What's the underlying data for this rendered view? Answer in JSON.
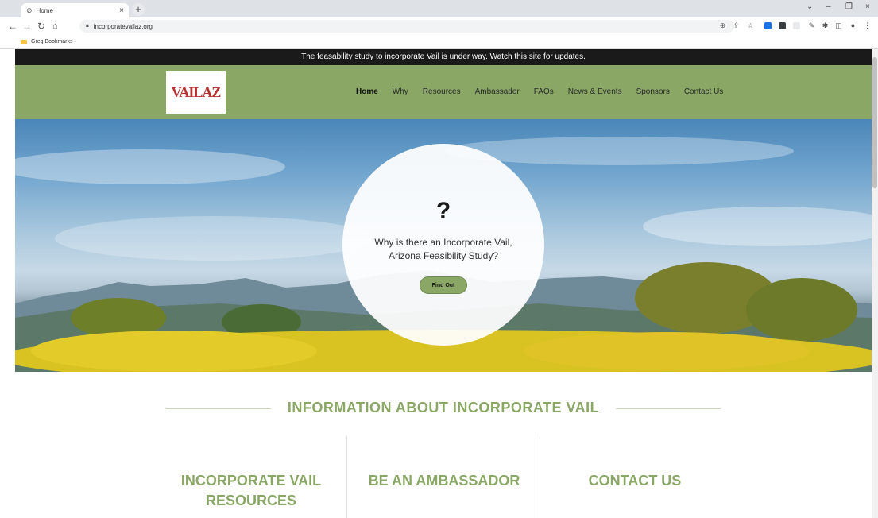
{
  "browser": {
    "tab_title": "Home",
    "url": "incorporatevailaz.org",
    "bookmark_folder": "Greg Bookmarks"
  },
  "site": {
    "announcement": "The feasability study to incorporate Vail is under way. Watch this site for updates.",
    "logo_text": "VAILAZ",
    "nav": [
      "Home",
      "Why",
      "Resources",
      "Ambassador",
      "FAQs",
      "News & Events",
      "Sponsors",
      "Contact Us"
    ],
    "hero": {
      "mark": "?",
      "text": "Why is there an Incorporate Vail, Arizona Feasibility Study?",
      "button": "Find Out"
    },
    "info_title": "INFORMATION ABOUT INCORPORATE VAIL",
    "columns": [
      "INCORPORATE VAIL RESOURCES",
      "BE AN AMBASSADOR",
      "CONTACT US"
    ]
  },
  "colors": {
    "brand_green": "#8aa766",
    "announce_bg": "#1a1a1a"
  }
}
